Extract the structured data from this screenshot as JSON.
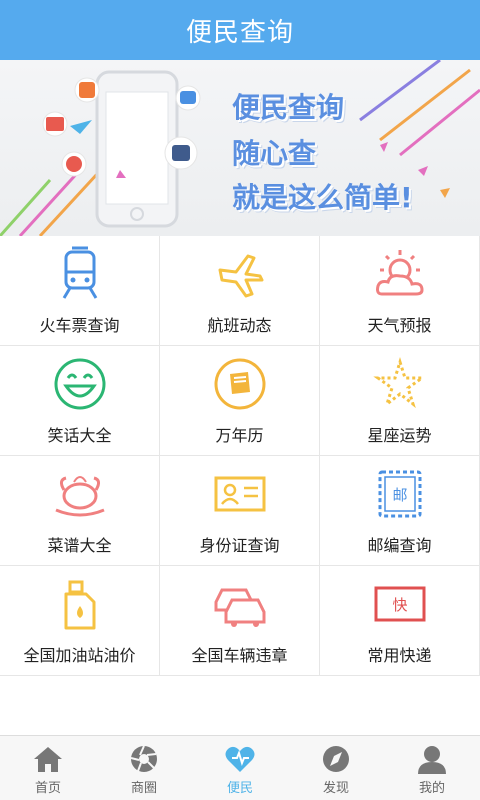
{
  "header": {
    "title": "便民查询"
  },
  "banner": {
    "line1": "便民查询",
    "line2": "随心查",
    "line3": "就是这么简单!"
  },
  "services": [
    {
      "label": "火车票查询",
      "icon": "train-icon",
      "color": "#4a90e2"
    },
    {
      "label": "航班动态",
      "icon": "plane-icon",
      "color": "#f5c242"
    },
    {
      "label": "天气预报",
      "icon": "weather-icon",
      "color": "#f08080"
    },
    {
      "label": "笑话大全",
      "icon": "smile-icon",
      "color": "#2bb673"
    },
    {
      "label": "万年历",
      "icon": "calendar-book-icon",
      "color": "#f3b53b"
    },
    {
      "label": "星座运势",
      "icon": "star-icon",
      "color": "#f5c242"
    },
    {
      "label": "菜谱大全",
      "icon": "roast-chicken-icon",
      "color": "#f08080"
    },
    {
      "label": "身份证查询",
      "icon": "id-card-icon",
      "color": "#f5c242"
    },
    {
      "label": "邮编查询",
      "icon": "postmark-icon",
      "color": "#4a90e2"
    },
    {
      "label": "全国加油站油价",
      "icon": "oil-can-icon",
      "color": "#f5c242"
    },
    {
      "label": "全国车辆违章",
      "icon": "cars-icon",
      "color": "#f08080"
    },
    {
      "label": "常用快递",
      "icon": "express-icon",
      "color": "#e05050"
    }
  ],
  "postmark_char": "邮",
  "express_char": "快",
  "tabs": [
    {
      "label": "首页",
      "icon": "home-icon",
      "active": false
    },
    {
      "label": "商圈",
      "icon": "aperture-icon",
      "active": false
    },
    {
      "label": "便民",
      "icon": "heart-icon",
      "active": true
    },
    {
      "label": "发现",
      "icon": "compass-icon",
      "active": false
    },
    {
      "label": "我的",
      "icon": "user-icon",
      "active": false
    }
  ],
  "colors": {
    "header": "#55aaee",
    "active_tab": "#4fb3e8",
    "inactive_tab": "#777777"
  }
}
